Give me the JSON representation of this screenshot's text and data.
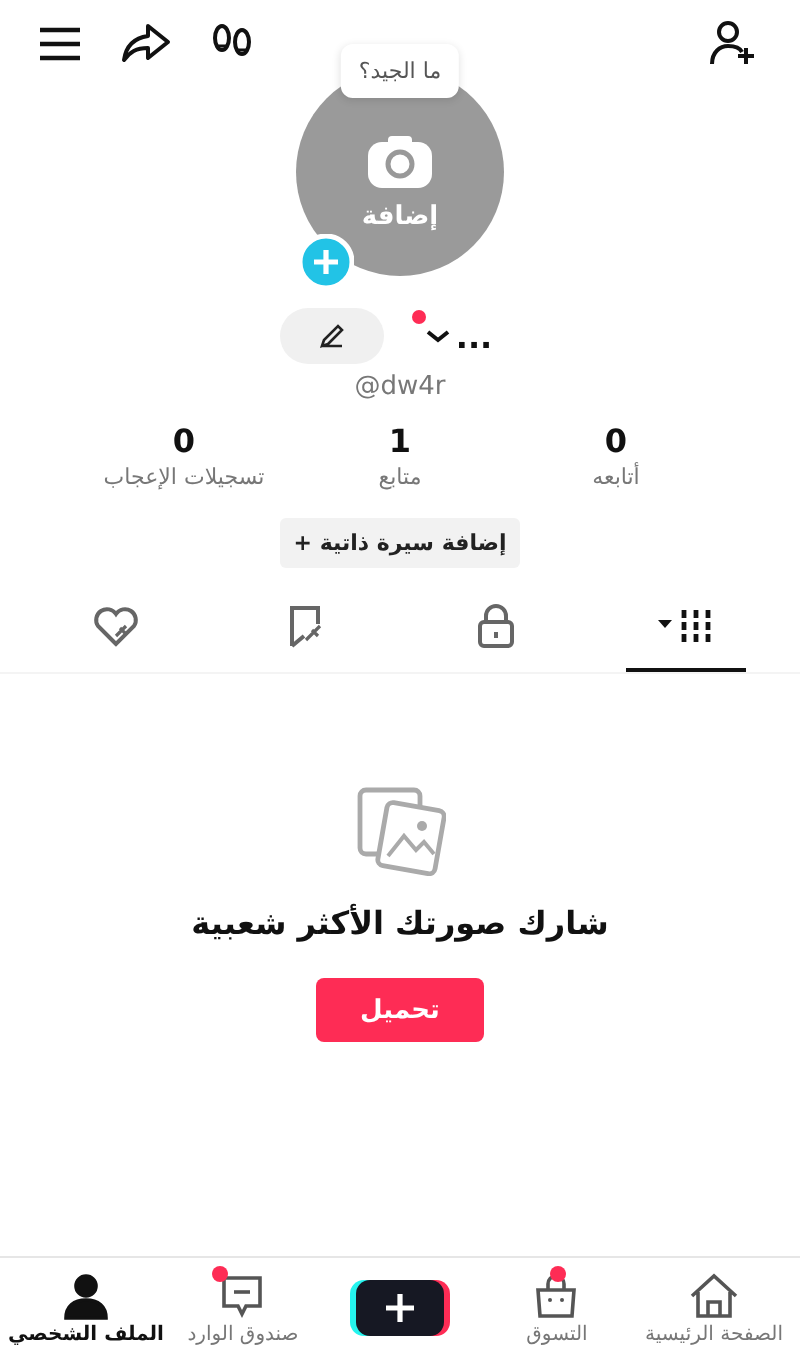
{
  "top_bar": {
    "icons": [
      {
        "kind": "menu"
      },
      {
        "kind": "share"
      },
      {
        "kind": "footprints"
      },
      {
        "kind": "add-friend"
      }
    ]
  },
  "profile": {
    "tooltip": "ما الجيد؟",
    "avatar_label": "إضافة",
    "name": "...",
    "name_badge": true,
    "handle": "@dw4r"
  },
  "stats": [
    {
      "value": "0",
      "label": "أتابعه"
    },
    {
      "value": "1",
      "label": "متابع"
    },
    {
      "value": "0",
      "label": "تسجيلات الإعجاب"
    }
  ],
  "bio_button": {
    "icon": "+",
    "label": "إضافة سيرة ذاتية"
  },
  "tabs": [
    {
      "kind": "videos",
      "selected": true
    },
    {
      "kind": "private",
      "selected": false
    },
    {
      "kind": "saved",
      "selected": false
    },
    {
      "kind": "liked",
      "selected": false
    }
  ],
  "empty_state": {
    "message": "شارك صورتك الأكثر شعبية",
    "button": "تحميل"
  },
  "bottom_nav": [
    {
      "kind": "home",
      "label": "الصفحة الرئيسية",
      "selected": false,
      "badge": false
    },
    {
      "kind": "shop",
      "label": "التسوق",
      "selected": false,
      "badge": true
    },
    {
      "kind": "create",
      "selected": false
    },
    {
      "kind": "inbox",
      "label": "صندوق الوارد",
      "selected": false,
      "badge": true
    },
    {
      "kind": "profile",
      "label": "الملف الشخصي",
      "selected": true,
      "badge": false
    }
  ]
}
